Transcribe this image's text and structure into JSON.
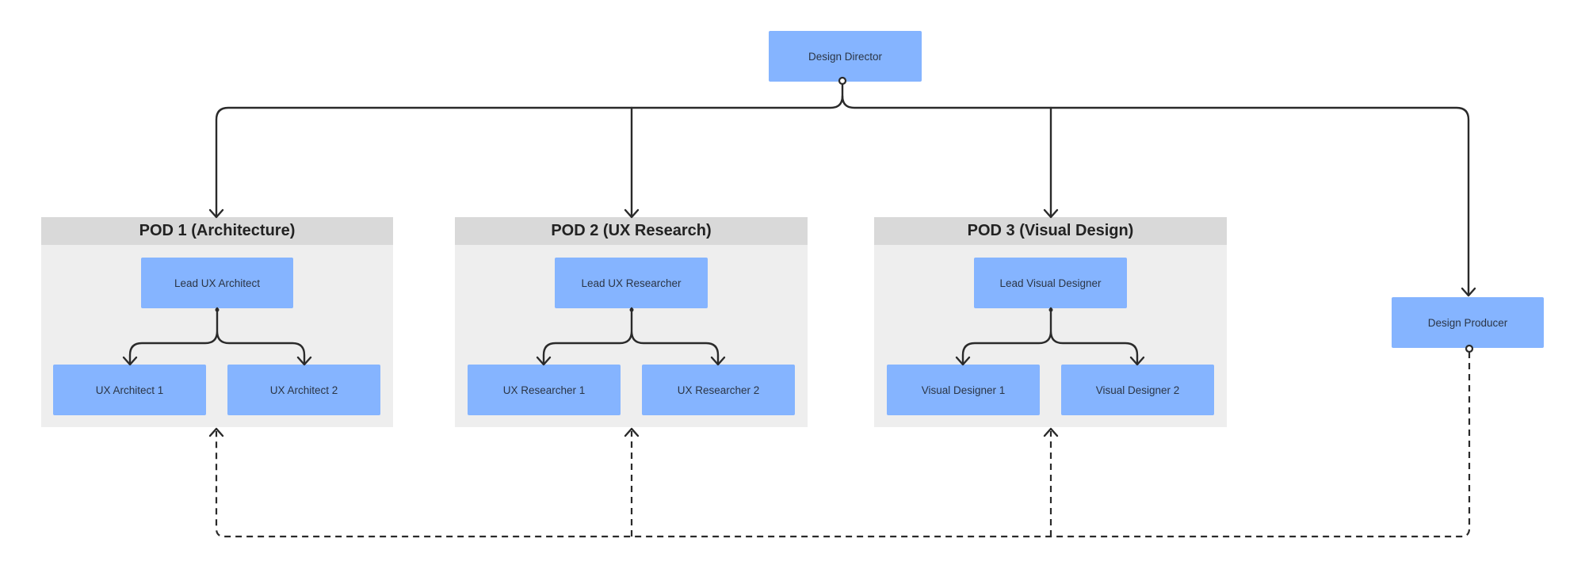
{
  "diagram": {
    "type": "org-chart",
    "root": {
      "label": "Design Director"
    },
    "pods": [
      {
        "title": "POD 1 (Architecture)",
        "lead": "Lead UX Architect",
        "members": [
          "UX Architect 1",
          "UX Architect 2"
        ]
      },
      {
        "title": "POD 2 (UX Research)",
        "lead": "Lead UX Researcher",
        "members": [
          "UX Researcher 1",
          "UX Researcher 2"
        ]
      },
      {
        "title": "POD 3 (Visual Design)",
        "lead": "Lead Visual Designer",
        "members": [
          "Visual Designer 1",
          "Visual Designer 2"
        ]
      }
    ],
    "side_node": {
      "label": "Design Producer"
    },
    "connections": [
      {
        "from": "Design Director",
        "to": "POD 1 (Architecture)",
        "style": "solid"
      },
      {
        "from": "Design Director",
        "to": "POD 2 (UX Research)",
        "style": "solid"
      },
      {
        "from": "Design Director",
        "to": "POD 3 (Visual Design)",
        "style": "solid"
      },
      {
        "from": "Design Director",
        "to": "Design Producer",
        "style": "solid"
      },
      {
        "from": "Lead UX Architect",
        "to": [
          "UX Architect 1",
          "UX Architect 2"
        ],
        "style": "solid"
      },
      {
        "from": "Lead UX Researcher",
        "to": [
          "UX Researcher 1",
          "UX Researcher 2"
        ],
        "style": "solid"
      },
      {
        "from": "Lead Visual Designer",
        "to": [
          "Visual Designer 1",
          "Visual Designer 2"
        ],
        "style": "solid"
      },
      {
        "from": "Design Producer",
        "to": [
          "POD 1 (Architecture)",
          "POD 2 (UX Research)",
          "POD 3 (Visual Design)"
        ],
        "style": "dashed"
      }
    ],
    "colors": {
      "node_fill": "#85b4ff",
      "pod_fill": "#eeeeee",
      "pod_header_fill": "#d9d9d9",
      "line": "#2a2a2a",
      "text": "#2b3545"
    }
  }
}
